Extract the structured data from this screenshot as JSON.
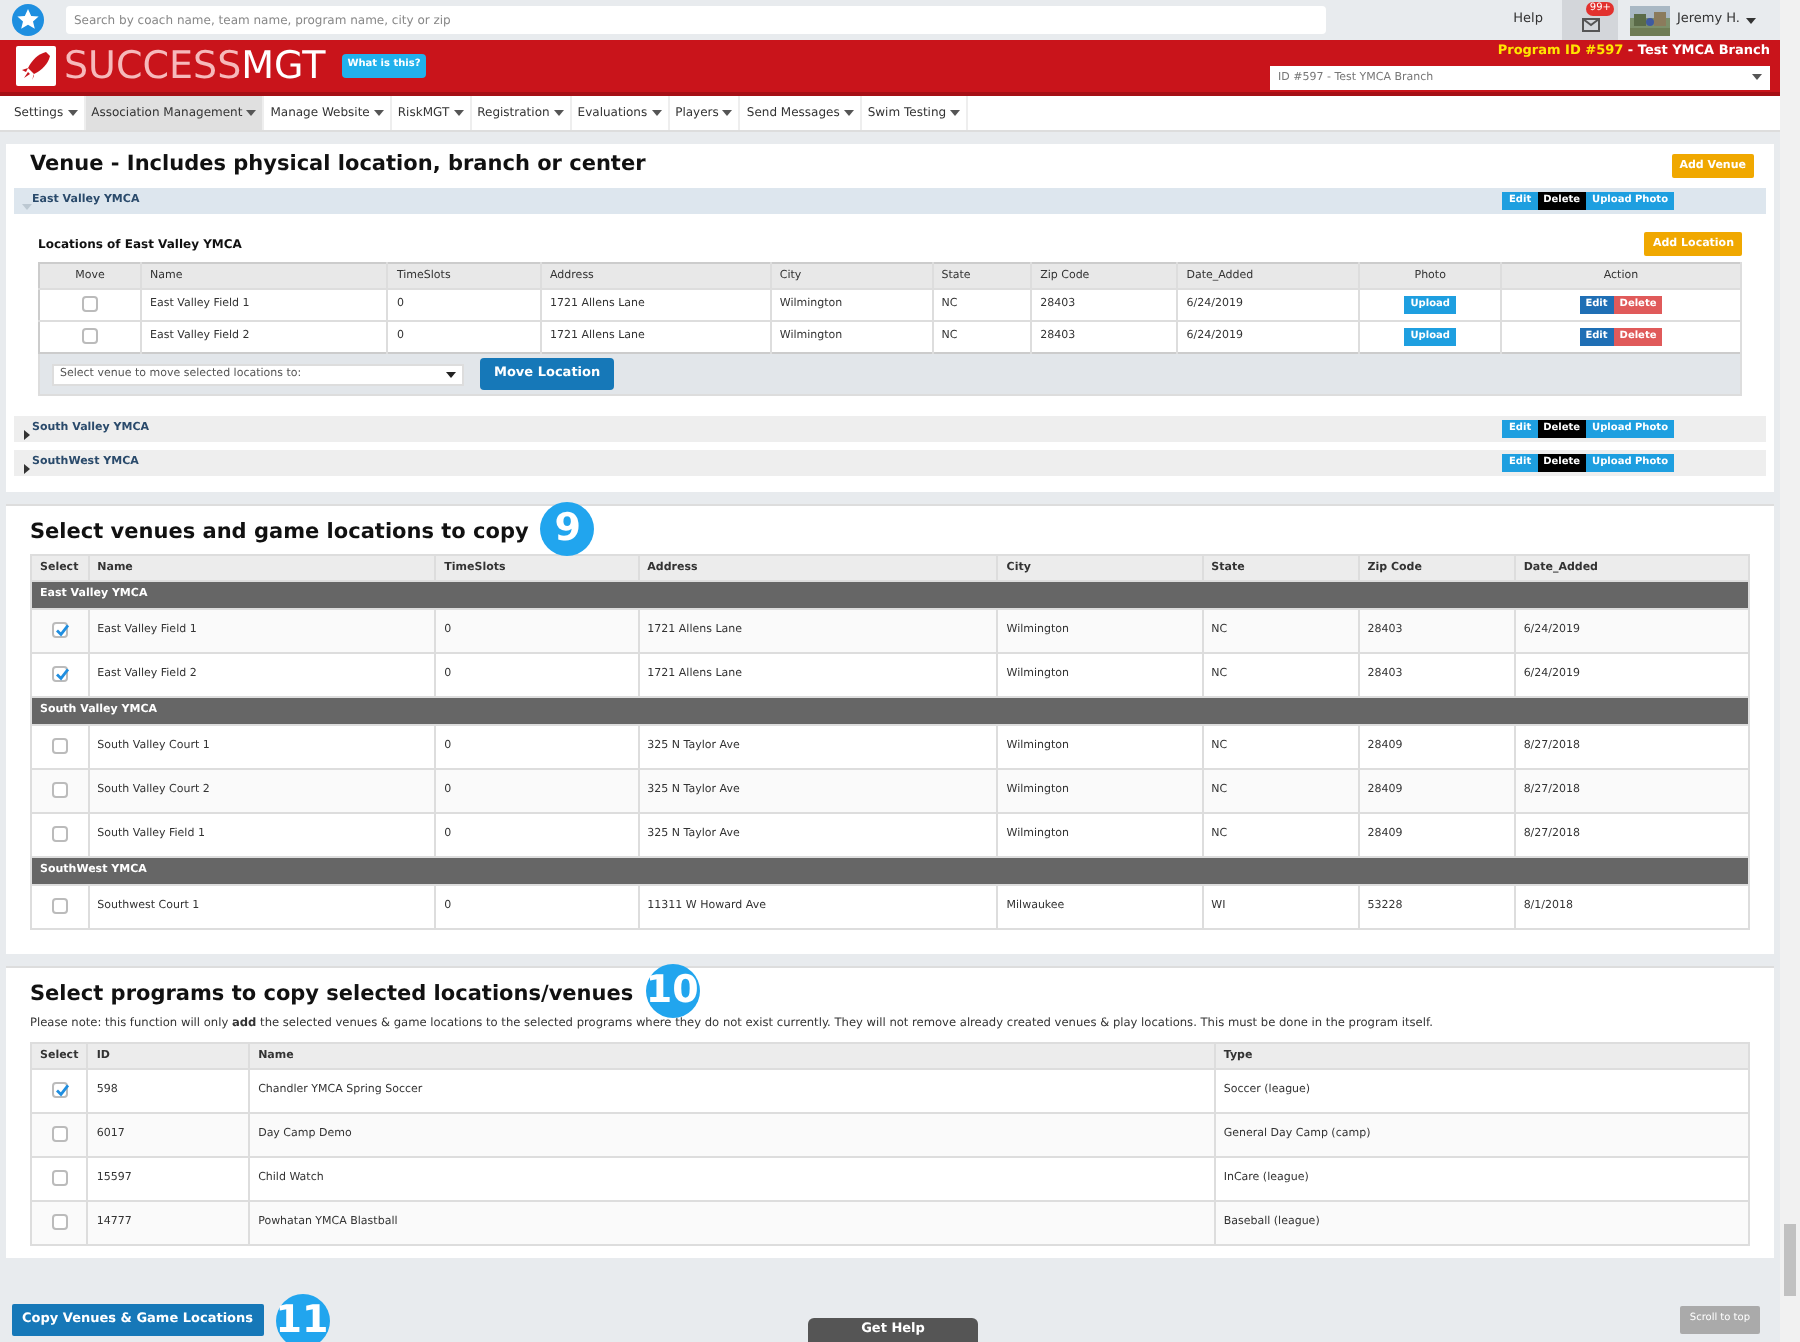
{
  "top_bar": {
    "search": {
      "placeholder": "Search by coach name, team name, program name, city or zip"
    },
    "help": "Help",
    "mail_badge": "99+",
    "user": "Jeremy H."
  },
  "header": {
    "logo_light": "SUCCESS",
    "logo_bold": "MGT",
    "what_is_this": "What is this?",
    "program_label": "Program ID #597",
    "program_name": " - Test YMCA Branch",
    "program_select": "ID #597 - Test YMCA Branch"
  },
  "menu": [
    {
      "label": "Settings",
      "selected": false
    },
    {
      "label": "Association Management",
      "selected": true
    },
    {
      "label": "Manage Website",
      "selected": false
    },
    {
      "label": "RiskMGT",
      "selected": false
    },
    {
      "label": "Registration",
      "selected": false
    },
    {
      "label": "Evaluations",
      "selected": false
    },
    {
      "label": "Players",
      "selected": false
    },
    {
      "label": "Send Messages",
      "selected": false
    },
    {
      "label": "Swim Testing",
      "selected": false
    }
  ],
  "venues": {
    "title": "Venue - Includes physical location, branch or center",
    "add_venue": "Add Venue",
    "groups": [
      {
        "name": "East Valley YMCA",
        "expanded": true,
        "buttons": [
          {
            "label": "Edit",
            "kind": "edit"
          },
          {
            "label": "Delete",
            "kind": "delete"
          },
          {
            "label": "Upload Photo",
            "kind": "upload"
          }
        ],
        "locations": {
          "title": "Locations of East Valley YMCA",
          "add_location": "Add Location",
          "check_column": "Move",
          "columns": [
            "Name",
            "TimeSlots",
            "Address",
            "City",
            "State",
            "Zip Code",
            "Date_Added"
          ],
          "photo_column": "Photo",
          "action_column": "Action",
          "rows": [
            {
              "checked": false,
              "cells": [
                "East Valley Field 1",
                "0",
                "1721 Allens Lane",
                "Wilmington",
                "NC",
                "28403",
                "6/24/2019"
              ],
              "photo": "Upload",
              "actions": [
                {
                  "label": "Edit",
                  "kind": "edit"
                },
                {
                  "label": "Delete",
                  "kind": "remove"
                }
              ]
            },
            {
              "checked": false,
              "cells": [
                "East Valley Field 2",
                "0",
                "1721 Allens Lane",
                "Wilmington",
                "NC",
                "28403",
                "6/24/2019"
              ],
              "photo": "Upload",
              "actions": [
                {
                  "label": "Edit",
                  "kind": "edit"
                },
                {
                  "label": "Delete",
                  "kind": "remove"
                }
              ]
            }
          ],
          "move_select": "Select venue to move selected locations to:",
          "move_button": "Move Location"
        }
      },
      {
        "name": "South Valley YMCA",
        "expanded": false,
        "buttons": [
          {
            "label": "Edit",
            "kind": "edit"
          },
          {
            "label": "Delete",
            "kind": "delete"
          },
          {
            "label": "Upload Photo",
            "kind": "upload"
          }
        ]
      },
      {
        "name": "SouthWest YMCA",
        "expanded": false,
        "buttons": [
          {
            "label": "Edit",
            "kind": "edit"
          },
          {
            "label": "Delete",
            "kind": "delete"
          },
          {
            "label": "Upload Photo",
            "kind": "upload"
          }
        ]
      }
    ]
  },
  "copy_locations": {
    "title": "Select venues and game locations to copy",
    "callout": "9",
    "check_column": "Select",
    "columns": [
      "Name",
      "TimeSlots",
      "Address",
      "City",
      "State",
      "Zip Code",
      "Date_Added"
    ],
    "groups": [
      {
        "name": "East Valley YMCA",
        "rows": [
          {
            "checked": true,
            "cells": [
              "East Valley Field 1",
              "0",
              "1721 Allens Lane",
              "Wilmington",
              "NC",
              "28403",
              "6/24/2019"
            ]
          },
          {
            "checked": true,
            "cells": [
              "East Valley Field 2",
              "0",
              "1721 Allens Lane",
              "Wilmington",
              "NC",
              "28403",
              "6/24/2019"
            ]
          }
        ]
      },
      {
        "name": "South Valley YMCA",
        "rows": [
          {
            "checked": false,
            "cells": [
              "South Valley Court 1",
              "0",
              "325 N Taylor Ave",
              "Wilmington",
              "NC",
              "28409",
              "8/27/2018"
            ]
          },
          {
            "checked": false,
            "cells": [
              "South Valley Court 2",
              "0",
              "325 N Taylor Ave",
              "Wilmington",
              "NC",
              "28409",
              "8/27/2018"
            ]
          },
          {
            "checked": false,
            "cells": [
              "South Valley Field 1",
              "0",
              "325 N Taylor Ave",
              "Wilmington",
              "NC",
              "28409",
              "8/27/2018"
            ]
          }
        ]
      },
      {
        "name": "SouthWest YMCA",
        "rows": [
          {
            "checked": false,
            "cells": [
              "Southwest Court 1",
              "0",
              "11311 W Howard Ave",
              "Milwaukee",
              "WI",
              "53228",
              "8/1/2018"
            ]
          }
        ]
      }
    ]
  },
  "copy_programs": {
    "title": "Select programs to copy selected locations/venues",
    "callout": "10",
    "note": "Please note: this function will only **add** the selected venues & game locations to the selected programs where they do not exist currently. They will not remove already created venues & play locations. This must be done in the program itself.",
    "check_column": "Select",
    "columns": [
      "ID",
      "Name",
      "Type"
    ],
    "rows": [
      {
        "checked": true,
        "cells": [
          "598",
          "Chandler YMCA Spring Soccer",
          "Soccer (league)"
        ]
      },
      {
        "checked": false,
        "cells": [
          "6017",
          "Day Camp Demo",
          "General Day Camp (camp)"
        ]
      },
      {
        "checked": false,
        "cells": [
          "15597",
          "Child Watch",
          "InCare (league)"
        ]
      },
      {
        "checked": false,
        "cells": [
          "14777",
          "Powhatan YMCA Blastball",
          "Baseball (league)"
        ]
      }
    ]
  },
  "footer": {
    "copy_button": "Copy Venues & Game Locations",
    "callout": "11",
    "get_help": "Get Help",
    "scroll_top": "Scroll to top"
  }
}
